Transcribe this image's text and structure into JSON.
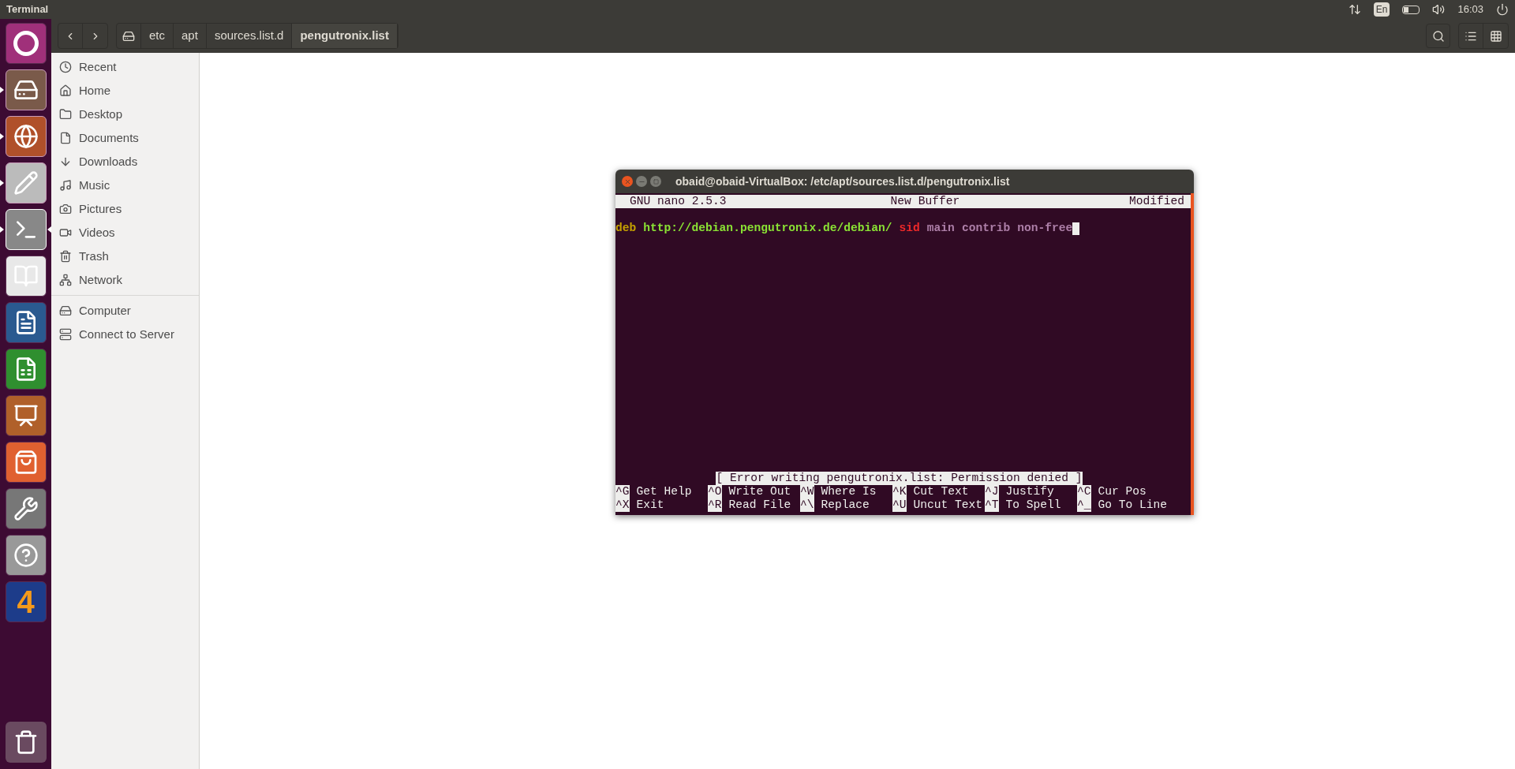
{
  "top_panel": {
    "title": "Terminal",
    "keyboard": "En",
    "clock": "16:03"
  },
  "launcher": [
    {
      "kind": "dash",
      "running": false,
      "focused": false
    },
    {
      "kind": "files",
      "running": true,
      "focused": false
    },
    {
      "kind": "browser",
      "running": true,
      "focused": false
    },
    {
      "kind": "editor",
      "running": true,
      "focused": false
    },
    {
      "kind": "terminal",
      "running": true,
      "focused": true
    },
    {
      "kind": "reader",
      "running": false,
      "focused": false
    },
    {
      "kind": "writer",
      "running": false,
      "focused": false
    },
    {
      "kind": "calc",
      "running": false,
      "focused": false
    },
    {
      "kind": "impress",
      "running": false,
      "focused": false
    },
    {
      "kind": "store",
      "running": false,
      "focused": false
    },
    {
      "kind": "settings",
      "running": false,
      "focused": false
    },
    {
      "kind": "help",
      "running": false,
      "focused": false
    },
    {
      "kind": "number",
      "label": "4",
      "running": false,
      "focused": false
    }
  ],
  "path_bar": [
    {
      "label": "etc",
      "selected": false
    },
    {
      "label": "apt",
      "selected": false
    },
    {
      "label": "sources.list.d",
      "selected": false
    },
    {
      "label": "pengutronix.list",
      "selected": true
    }
  ],
  "sidebar": {
    "groups": [
      [
        {
          "label": "Recent"
        },
        {
          "label": "Home"
        },
        {
          "label": "Desktop"
        },
        {
          "label": "Documents"
        },
        {
          "label": "Downloads"
        },
        {
          "label": "Music"
        },
        {
          "label": "Pictures"
        },
        {
          "label": "Videos"
        },
        {
          "label": "Trash"
        },
        {
          "label": "Network"
        }
      ],
      [
        {
          "label": "Computer"
        },
        {
          "label": "Connect to Server"
        }
      ]
    ]
  },
  "terminal": {
    "title": "obaid@obaid-VirtualBox: /etc/apt/sources.list.d/pengutronix.list",
    "nano_header": {
      "version": "GNU nano 2.5.3",
      "buffer": "New Buffer",
      "status": "Modified"
    },
    "line": [
      {
        "text": "deb",
        "color": "#c4a000"
      },
      {
        "text": "http://debian.pengutronix.de/debian/",
        "color": "#8ae234"
      },
      {
        "text": "sid",
        "color": "#ef2929"
      },
      {
        "text": "main",
        "color": "#ad7fa8"
      },
      {
        "text": "contrib",
        "color": "#ad7fa8"
      },
      {
        "text": "non-free",
        "color": "#ad7fa8"
      }
    ],
    "message": "[ Error writing pengutronix.list: Permission denied ]",
    "shortcuts": [
      [
        {
          "key": "^G",
          "label": "Get Help"
        },
        {
          "key": "^O",
          "label": "Write Out"
        },
        {
          "key": "^W",
          "label": "Where Is"
        },
        {
          "key": "^K",
          "label": "Cut Text"
        },
        {
          "key": "^J",
          "label": "Justify"
        },
        {
          "key": "^C",
          "label": "Cur Pos"
        }
      ],
      [
        {
          "key": "^X",
          "label": "Exit"
        },
        {
          "key": "^R",
          "label": "Read File"
        },
        {
          "key": "^\\",
          "label": "Replace"
        },
        {
          "key": "^U",
          "label": "Uncut Text"
        },
        {
          "key": "^T",
          "label": "To Spell"
        },
        {
          "key": "^_",
          "label": "Go To Line"
        }
      ]
    ]
  }
}
